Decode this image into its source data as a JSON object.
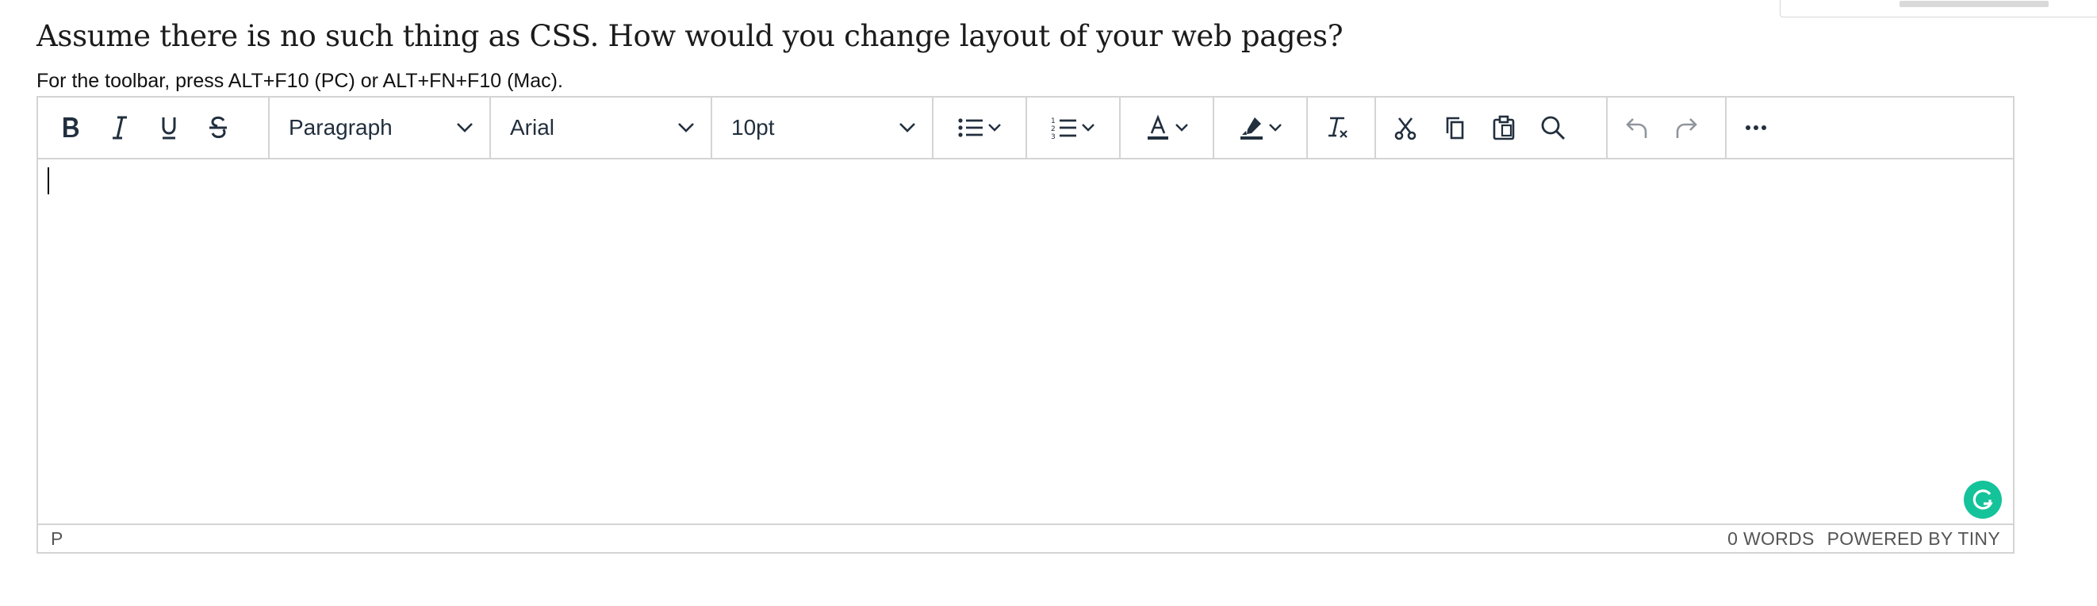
{
  "page": {
    "question": "Assume there is no such thing as CSS. How would you change layout of your web pages?",
    "toolbar_hint": "For the toolbar, press ALT+F10 (PC) or ALT+FN+F10 (Mac)."
  },
  "toolbar": {
    "format_buttons": [
      "bold-icon",
      "italic-icon",
      "underline-icon",
      "strikethrough-icon"
    ],
    "block_format": "Paragraph",
    "font_family": "Arial",
    "font_size": "10pt",
    "icons": [
      "bullet-list-icon",
      "numbered-list-icon",
      "text-color-icon",
      "highlight-icon",
      "clear-formatting-icon",
      "cut-icon",
      "copy-icon",
      "paste-icon",
      "search-icon",
      "undo-icon",
      "redo-icon",
      "more-icon"
    ]
  },
  "statusbar": {
    "path": "P",
    "word_count": "0 WORDS",
    "branding": "POWERED BY TINY"
  },
  "colors": {
    "icon": "#222f3e",
    "border": "#d4d4d4",
    "grammarly": "#15c39a",
    "disabled": "#8f959c"
  }
}
